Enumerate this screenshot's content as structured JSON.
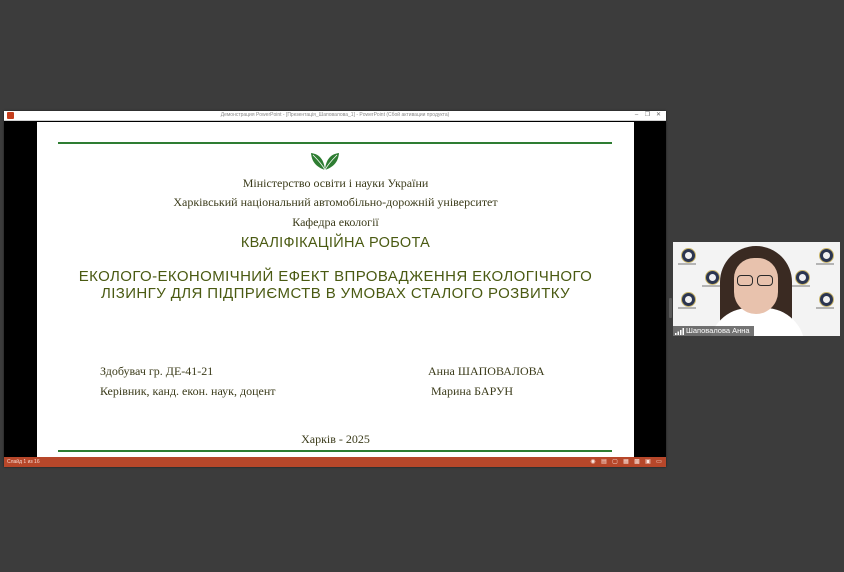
{
  "window": {
    "title": "Демонстрация PowerPoint - [Презентація_Шаповалова_1] - PowerPoint (Сбой активации продукта)",
    "minimize": "–",
    "restore": "❐",
    "close": "✕"
  },
  "slide": {
    "ministry": "Міністерство освіти і науки України",
    "university": "Харківський національний автомобільно-дорожній університет",
    "department": "Кафедра екології",
    "work_type": "КВАЛІФІКАЦІЙНА РОБОТА",
    "topic_line1": "ЕКОЛОГО-ЕКОНОМІЧНИЙ ЕФЕКТ ВПРОВАДЖЕННЯ ЕКОЛОГІЧНОГО",
    "topic_line2": "ЛІЗИНГУ ДЛЯ ПІДПРИЄМСТВ В УМОВАХ СТАЛОГО РОЗВИТКУ",
    "applicant_label": "Здобувач гр. ДЕ-41-21",
    "applicant_name": "Анна ШАПОВАЛОВА",
    "supervisor_label": "Керівник, канд. екон. наук, доцент",
    "supervisor_name": "Марина БАРУН",
    "city_year": "Харків - 2025",
    "accent_color": "#2e7d32"
  },
  "statusbar": {
    "slide_counter": "Слайд 1 из 16",
    "color": "#b7472a"
  },
  "webcam": {
    "participant_name": "Шаповалова Анна"
  }
}
